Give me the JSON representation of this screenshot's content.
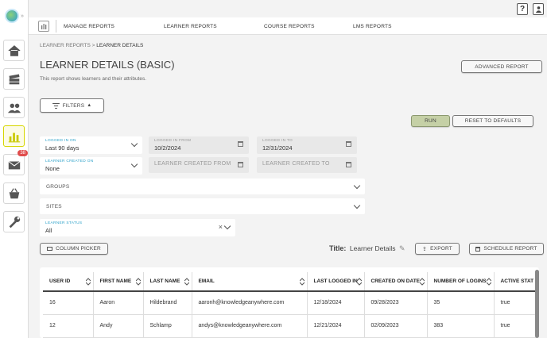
{
  "sidebar": {
    "messages_badge": "38"
  },
  "topbar": {
    "help_label": "?"
  },
  "nav": {
    "items": [
      "MANAGE REPORTS",
      "LEARNER REPORTS",
      "COURSE REPORTS",
      "LMS REPORTS"
    ]
  },
  "breadcrumb": {
    "parent": "LEARNER REPORTS",
    "separator": ">",
    "current": "LEARNER DETAILS"
  },
  "page": {
    "title": "LEARNER DETAILS (BASIC)",
    "subtitle": "This report shows learners and their attributes."
  },
  "buttons": {
    "advanced_report": "ADVANCED REPORT",
    "filters": "FILTERS",
    "run": "RUN",
    "reset": "RESET TO DEFAULTS",
    "column_picker": "COLUMN PICKER",
    "export": "EXPORT",
    "schedule_report": "SCHEDULE REPORT"
  },
  "filters": {
    "logged_in_on": {
      "label": "LOGGED IN ON",
      "value": "Last 90 days"
    },
    "logged_in_from": {
      "label": "LOGGED IN FROM",
      "value": "10/2/2024"
    },
    "logged_in_to": {
      "label": "LOGGED IN TO",
      "value": "12/31/2024"
    },
    "learner_created_on": {
      "label": "LEARNER CREATED ON",
      "value": "None"
    },
    "learner_created_from": {
      "placeholder": "LEARNER CREATED FROM"
    },
    "learner_created_to": {
      "placeholder": "LEARNER CREATED TO"
    },
    "groups": {
      "label": "GROUPS"
    },
    "sites": {
      "label": "SITES"
    },
    "learner_status": {
      "label": "LEARNER STATUS",
      "value": "All",
      "clear": "×"
    }
  },
  "report": {
    "title_label": "Title:",
    "title_value": "Learner Details"
  },
  "table": {
    "columns": [
      "USER ID",
      "FIRST NAME",
      "LAST NAME",
      "EMAIL",
      "LAST LOGGED IN",
      "CREATED ON DATE",
      "NUMBER OF LOGINS",
      "ACTIVE STAT"
    ],
    "rows": [
      [
        "16",
        "Aaron",
        "Hildebrand",
        "aaronh@knowledgeanywhere.com",
        "12/18/2024",
        "09/28/2023",
        "35",
        "true"
      ],
      [
        "12",
        "Andy",
        "Schlamp",
        "andys@knowledgeanywhere.com",
        "12/21/2024",
        "02/09/2023",
        "383",
        "true"
      ]
    ]
  },
  "colors": {
    "run_button": "#c5d0a6",
    "accent": "#2aa0c8",
    "badge": "#e04c4c"
  }
}
